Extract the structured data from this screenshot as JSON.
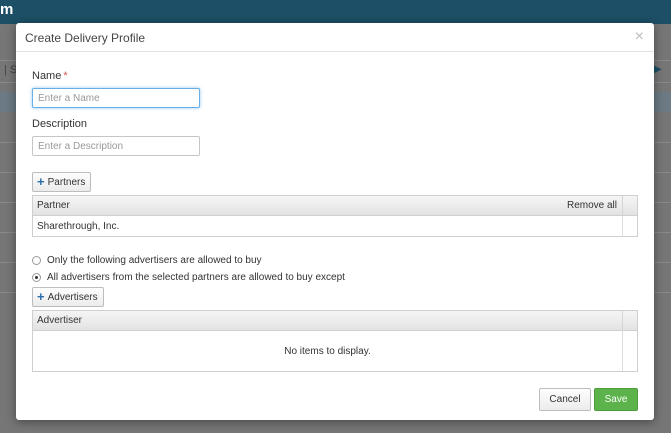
{
  "app": {
    "title_fragment": "m",
    "left_fragment": "| S"
  },
  "dialog": {
    "title": "Create Delivery Profile",
    "close_glyph": "×",
    "name_label": "Name",
    "required_mark": "*",
    "name_placeholder": "Enter a Name",
    "name_value": "",
    "description_label": "Description",
    "description_placeholder": "Enter a Description",
    "description_value": "",
    "partners_button": "Partners",
    "partners_grid": {
      "column": "Partner",
      "action": "Remove all",
      "rows": [
        "Sharethrough, Inc."
      ]
    },
    "radio_options": [
      {
        "label": "Only the following advertisers are allowed to buy",
        "checked": false
      },
      {
        "label": "All advertisers from the selected partners are allowed to buy except",
        "checked": true
      }
    ],
    "advertisers_button": "Advertisers",
    "advertisers_grid": {
      "column": "Advertiser",
      "empty_message": "No items to display."
    },
    "cancel_label": "Cancel",
    "save_label": "Save"
  },
  "colors": {
    "header": "#1d4f66",
    "save": "#5cb34b",
    "plus_icon": "#2a6fa8",
    "required": "#d9534f"
  },
  "icons": {
    "plus": "plus-icon",
    "close": "close-icon",
    "right_arrow": "arrow-right-icon"
  }
}
